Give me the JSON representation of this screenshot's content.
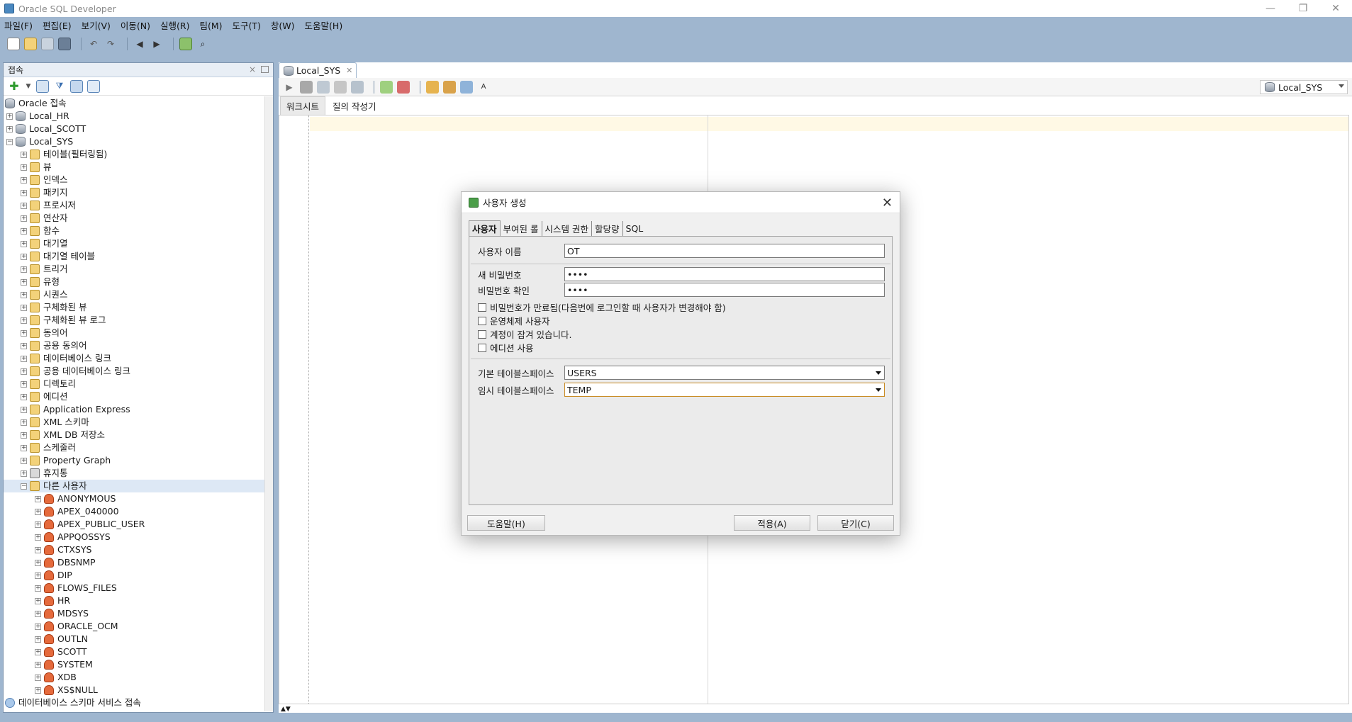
{
  "window": {
    "title": "Oracle SQL Developer"
  },
  "menu": [
    "파일(F)",
    "편집(E)",
    "보기(V)",
    "이동(N)",
    "실행(R)",
    "팀(M)",
    "도구(T)",
    "창(W)",
    "도움말(H)"
  ],
  "connections_panel": {
    "title": "접속",
    "root": "Oracle 접속",
    "connections": [
      {
        "label": "Local_HR",
        "expanded": false
      },
      {
        "label": "Local_SCOTT",
        "expanded": false
      },
      {
        "label": "Local_SYS",
        "expanded": true
      }
    ],
    "sys_children": [
      "테이블(필터링됨)",
      "뷰",
      "인덱스",
      "패키지",
      "프로시저",
      "연산자",
      "함수",
      "대기열",
      "대기열 테이블",
      "트리거",
      "유형",
      "시퀀스",
      "구체화된 뷰",
      "구체화된 뷰 로그",
      "동의어",
      "공용 동의어",
      "데이터베이스 링크",
      "공용 데이터베이스 링크",
      "디렉토리",
      "에디션",
      "Application Express",
      "XML 스키마",
      "XML DB 저장소",
      "스케줄러",
      "Property Graph",
      "휴지통",
      "다른 사용자"
    ],
    "other_users": [
      "ANONYMOUS",
      "APEX_040000",
      "APEX_PUBLIC_USER",
      "APPQOSSYS",
      "CTXSYS",
      "DBSNMP",
      "DIP",
      "FLOWS_FILES",
      "HR",
      "MDSYS",
      "ORACLE_OCM",
      "OUTLN",
      "SCOTT",
      "SYSTEM",
      "XDB",
      "XS$NULL"
    ],
    "footer_node": "데이터베이스 스키마 서비스 접속"
  },
  "editor": {
    "tab_label": "Local_SYS",
    "connection_select": "Local_SYS",
    "subtabs": [
      "워크시트",
      "질의 작성기"
    ],
    "active_subtab": "워크시트"
  },
  "dialog": {
    "title": "사용자 생성",
    "tabs": [
      "사용자",
      "부여된 롤",
      "시스템 권한",
      "할당량",
      "SQL"
    ],
    "active_tab": "사용자",
    "username_label": "사용자 이름",
    "username_value": "OT",
    "new_password_label": "새 비밀번호",
    "new_password_value": "••••",
    "confirm_password_label": "비밀번호 확인",
    "confirm_password_value": "••••",
    "checkboxes": [
      {
        "label": "비밀번호가 만료됨(다음번에 로그인할 때 사용자가 변경해야 함)",
        "checked": false
      },
      {
        "label": "운영체제 사용자",
        "checked": false
      },
      {
        "label": "계정이 잠겨 있습니다.",
        "checked": false
      },
      {
        "label": "에디션 사용",
        "checked": false
      }
    ],
    "default_tablespace_label": "기본 테이블스페이스",
    "default_tablespace_value": "USERS",
    "temp_tablespace_label": "임시 테이블스페이스",
    "temp_tablespace_value": "TEMP",
    "help_button": "도움말(H)",
    "apply_button": "적용(A)",
    "close_button": "닫기(C)"
  }
}
